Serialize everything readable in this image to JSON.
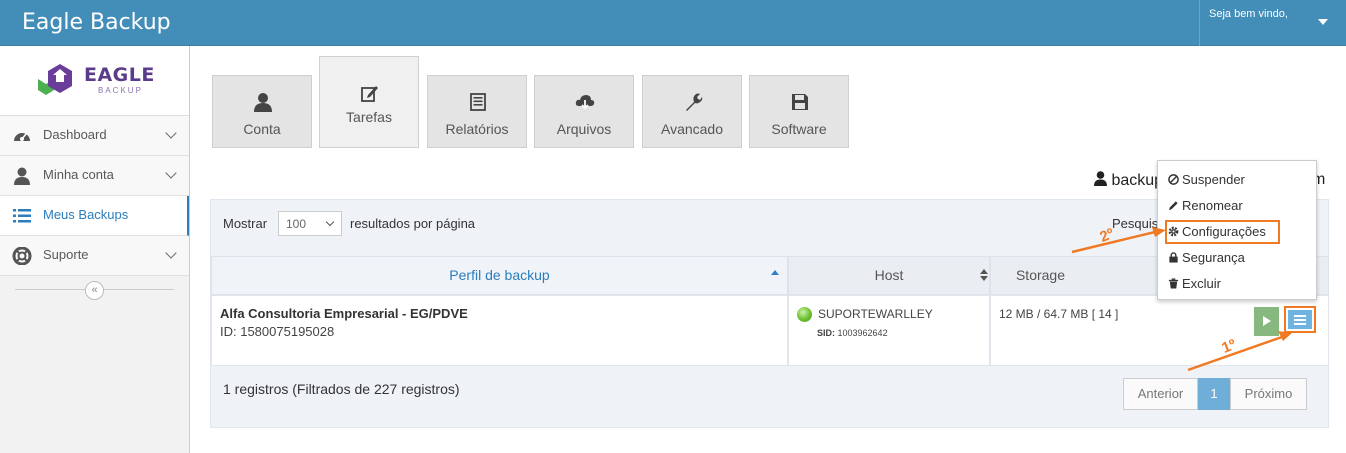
{
  "app": {
    "title": "Eagle Backup",
    "welcome": "Seja bem vindo,"
  },
  "logo": {
    "name": "EAGLE",
    "sub": "BACKUP"
  },
  "sidebar": {
    "items": [
      {
        "label": "Dashboard",
        "icon": "dashboard-icon"
      },
      {
        "label": "Minha conta",
        "icon": "user-icon"
      },
      {
        "label": "Meus Backups",
        "icon": "list-icon"
      },
      {
        "label": "Suporte",
        "icon": "lifebuoy-icon"
      }
    ],
    "collapse_glyph": "«"
  },
  "tabs": [
    {
      "label": "Conta",
      "icon": "user-icon"
    },
    {
      "label": "Tarefas",
      "icon": "edit-icon"
    },
    {
      "label": "Relatórios",
      "icon": "report-icon"
    },
    {
      "label": "Arquivos",
      "icon": "cloud-download-icon"
    },
    {
      "label": "Avancado",
      "icon": "wrench-icon"
    },
    {
      "label": "Software",
      "icon": "save-icon"
    }
  ],
  "user_line": {
    "prefix": "backup",
    "suffix": "m"
  },
  "table": {
    "show_label": "Mostrar",
    "page_size": "100",
    "show_suffix": "resultados por página",
    "search_label": "Pesquis",
    "columns": [
      "Perfil de backup",
      "Host",
      "Storage"
    ],
    "rows": [
      {
        "name": "Alfa Consultoria Empresarial - EG/PDVE",
        "id": "ID: 1580075195028",
        "host": "SUPORTEWARLLEY",
        "sid_label": "SID:",
        "sid": "1003962642",
        "storage": "12 MB / 64.7 MB [ 14 ]"
      }
    ],
    "footer": "1 registros (Filtrados de 227 registros)",
    "pagination": {
      "prev": "Anterior",
      "current": "1",
      "next": "Próximo"
    }
  },
  "dropdown": {
    "items": [
      {
        "label": "Suspender",
        "icon": "ban-icon"
      },
      {
        "label": "Renomear",
        "icon": "pencil-icon"
      },
      {
        "label": "Configurações",
        "icon": "cog-icon"
      },
      {
        "label": "Segurança",
        "icon": "lock-icon"
      },
      {
        "label": "Excluir",
        "icon": "trash-icon"
      }
    ]
  },
  "annotations": {
    "first": "1º",
    "second": "2º",
    "color": "#f07a24"
  },
  "colors": {
    "header": "#438eb9",
    "accent": "#2b7dbc",
    "play": "#87b87f",
    "menu": "#6fb3e0"
  }
}
